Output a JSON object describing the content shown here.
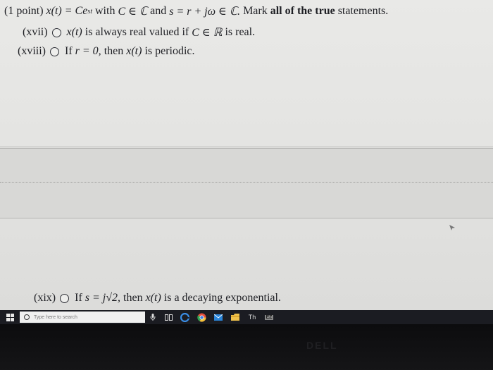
{
  "header": {
    "prefix": "(1 point)",
    "formula": "x(t) = Ce",
    "formula_sup": "st",
    "with_text": "with",
    "c_membership": "C ∈ ℂ",
    "and_text": "and",
    "s_def": "s = r + jω ∈ ℂ.",
    "instruction_pre": "Mark",
    "instruction_bold": "all of the true",
    "instruction_post": "statements."
  },
  "questions": [
    {
      "num": "(xvii)",
      "math_lead": "x(t)",
      "text": "is always real valued if",
      "math_cond": "C ∈ ℝ",
      "tail": "is real."
    },
    {
      "num": "(xviii)",
      "lead": "If",
      "math_cond": "r = 0,",
      "text": "then",
      "math_lead": "x(t)",
      "tail": "is periodic."
    },
    {
      "num": "(xix)",
      "lead": "If",
      "math_cond": "s = j√2,",
      "text": "then",
      "math_lead": "x(t)",
      "tail": "is a decaying exponential."
    }
  ],
  "taskbar": {
    "search_placeholder": "Type here to search",
    "icons": [
      "windows-icon",
      "search-icon",
      "mic-icon",
      "task-view-icon",
      "edge-icon",
      "chrome-icon",
      "mail-icon",
      "file-explorer-icon",
      "app-icon",
      "store-icon"
    ],
    "app_label": "Th",
    "store_label": "EZ"
  },
  "bezel": {
    "brand": "DELL"
  }
}
